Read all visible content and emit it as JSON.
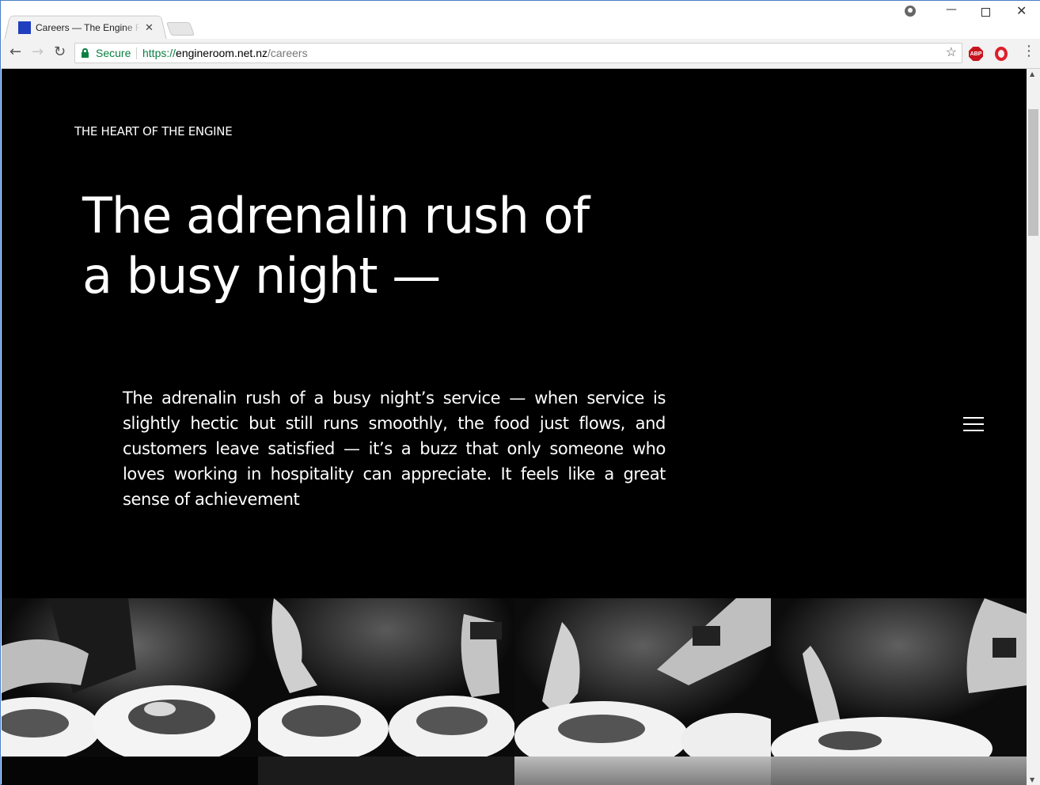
{
  "browser": {
    "tab_title": "Careers — The Engine Room",
    "tab_close": "✕",
    "security_label": "Secure",
    "url_scheme": "https://",
    "url_host": "engineroom.net.nz",
    "url_path": "/careers",
    "extensions": {
      "abp": "ABP"
    }
  },
  "page": {
    "eyebrow": "THE HEART OF THE ENGINE",
    "headline_line1": "The adrenalin rush of",
    "headline_line2": "a busy night —",
    "body": "The adrenalin rush of a busy night’s service — when service is slightly hectic but still runs smoothly, the food just flows, and customers leave satisfied — it’s a buzz that only someone who loves working in hospitality can appreciate. It feels like a great sense of achievement",
    "menu_icon": "hamburger-icon"
  },
  "colors": {
    "page_background": "#000000",
    "text": "#ffffff",
    "secure_green": "#0b8043",
    "favicon_blue": "#1f3fbf"
  }
}
